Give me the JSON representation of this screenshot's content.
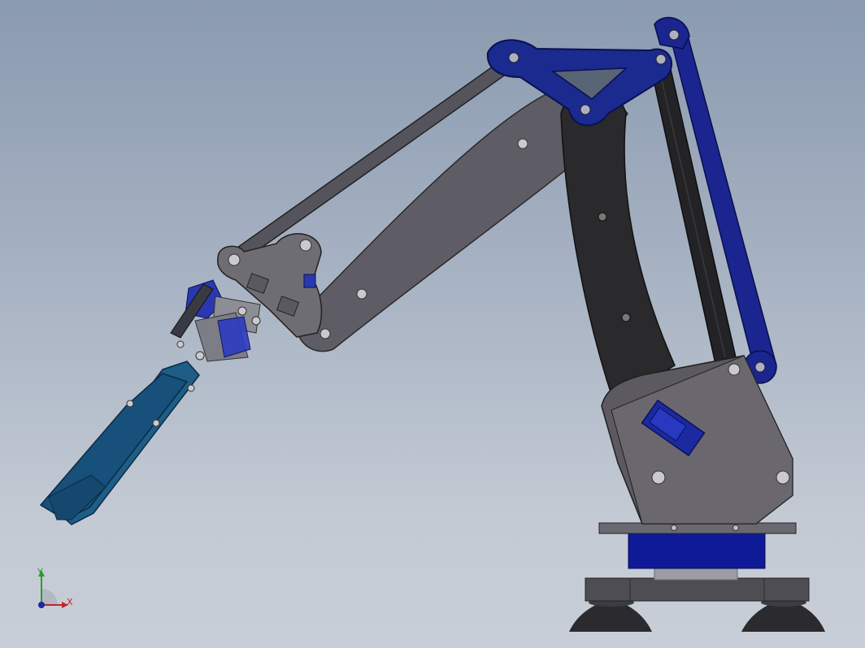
{
  "view": {
    "triad": {
      "x_label": "X",
      "y_label": "Y"
    },
    "colors": {
      "bg_top": "#8a9ab0",
      "bg_bottom": "#c8ced8",
      "gray_plate": "#5f5d63",
      "dark_link": "#2a2a2c",
      "blue_part": "#1b2a8c",
      "teal_gripper": "#1f5b82"
    }
  }
}
